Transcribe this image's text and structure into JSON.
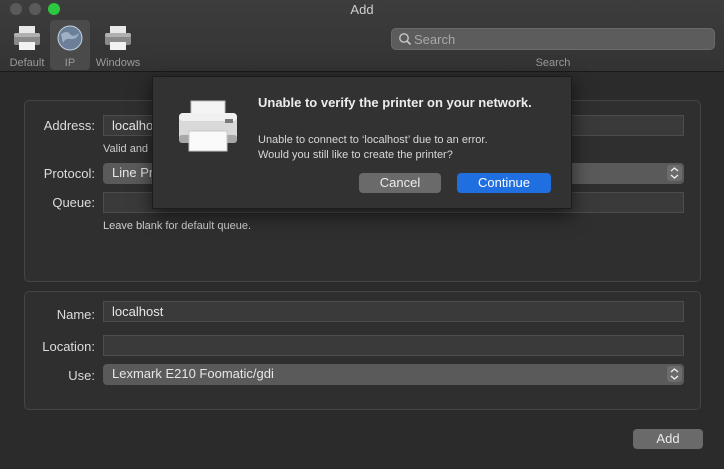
{
  "window": {
    "title": "Add"
  },
  "toolbar": {
    "items": [
      {
        "label": "Default",
        "icon": "printer-icon"
      },
      {
        "label": "IP",
        "icon": "globe-icon",
        "selected": true
      },
      {
        "label": "Windows",
        "icon": "printer-icon"
      }
    ],
    "search": {
      "placeholder": "Search",
      "value": "",
      "caption": "Search"
    }
  },
  "form": {
    "address": {
      "label": "Address:",
      "value": "localhost",
      "note": "Valid and"
    },
    "protocol": {
      "label": "Protocol:",
      "value": "Line Pr"
    },
    "queue": {
      "label": "Queue:",
      "value": "",
      "note": "Leave blank for default queue."
    },
    "name": {
      "label": "Name:",
      "value": "localhost"
    },
    "location": {
      "label": "Location:",
      "value": ""
    },
    "use": {
      "label": "Use:",
      "value": "Lexmark E210 Foomatic/gdi"
    }
  },
  "add_button": "Add",
  "dialog": {
    "title": "Unable to verify the printer on your network.",
    "message_line1": "Unable to connect to ‘localhost’ due to an error.",
    "message_line2": "Would you still like to create the printer?",
    "cancel_label": "Cancel",
    "continue_label": "Continue",
    "accent_color": "#1f6fe0"
  }
}
